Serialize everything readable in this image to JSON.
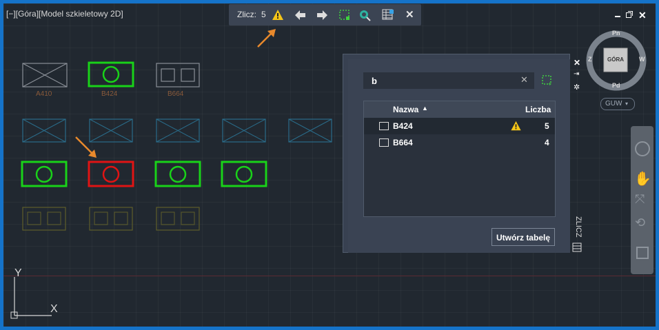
{
  "viewport": {
    "label": "[−][Góra][Model szkieletowy 2D]",
    "ucs_y": "Y",
    "ucs_x": "X"
  },
  "toolbar": {
    "count_label": "Zlicz:",
    "count_value": "5"
  },
  "blocks": {
    "labels": [
      "A410",
      "B424",
      "B664"
    ]
  },
  "panel": {
    "search_value": "b",
    "columns": {
      "name": "Nazwa",
      "count": "Liczba"
    },
    "rows": [
      {
        "name": "B424",
        "count": "5",
        "warning": true
      },
      {
        "name": "B664",
        "count": "4",
        "warning": false
      }
    ],
    "create_table_button": "Utwórz tabelę",
    "side_title": "ZLICZ"
  },
  "viewcube": {
    "north": "Pn",
    "south": "Pd",
    "east": "W",
    "west": "Z",
    "face": "GÓRA",
    "ucs_menu": "GUW"
  },
  "colors": {
    "accent_orange": "#e8892c",
    "warning_yellow": "#f5c518",
    "block_green": "#19d219",
    "block_red": "#e01414"
  }
}
